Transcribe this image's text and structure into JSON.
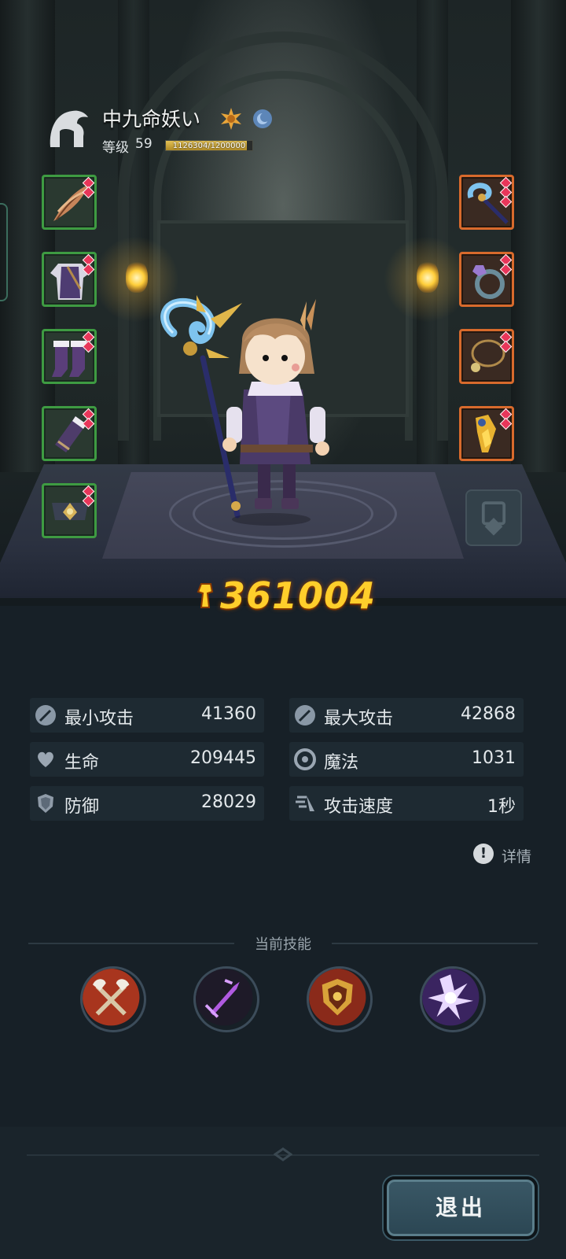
{
  "player": {
    "name": "中九命妖い",
    "level_label": "等级",
    "level": "59",
    "xp_text": "1126304/1200000",
    "xp_fraction": 0.9386
  },
  "equipment": {
    "left": [
      {
        "item": "feather-quill",
        "icon": "feather-icon"
      },
      {
        "item": "purple-tunic",
        "icon": "armor-icon"
      },
      {
        "item": "purple-boots",
        "icon": "boots-icon"
      },
      {
        "item": "bracer",
        "icon": "bracer-icon"
      },
      {
        "item": "belt",
        "icon": "belt-icon"
      }
    ],
    "right": [
      {
        "item": "ice-staff",
        "icon": "staff-icon"
      },
      {
        "item": "gem-ring",
        "icon": "ring-icon"
      },
      {
        "item": "necklace",
        "icon": "necklace-icon"
      },
      {
        "item": "gold-amulet",
        "icon": "amulet-icon"
      }
    ]
  },
  "power": "361004",
  "stats": [
    {
      "label": "最小攻击",
      "value": "41360",
      "icon": "sword-icon"
    },
    {
      "label": "最大攻击",
      "value": "42868",
      "icon": "sword-icon"
    },
    {
      "label": "生命",
      "value": "209445",
      "icon": "heart-icon"
    },
    {
      "label": "魔法",
      "value": "1031",
      "icon": "magic-icon"
    },
    {
      "label": "防御",
      "value": "28029",
      "icon": "shield-icon"
    },
    {
      "label": "攻击速度",
      "value": "1秒",
      "icon": "speed-icon"
    }
  ],
  "details_label": "详情",
  "skills": {
    "title": "当前技能",
    "items": [
      {
        "name": "crossed-axes",
        "icon": "axes-icon"
      },
      {
        "name": "purple-sword",
        "icon": "purple-sword-icon"
      },
      {
        "name": "golden-shield",
        "icon": "shield-crest-icon"
      },
      {
        "name": "lightning-burst",
        "icon": "lightning-icon"
      }
    ]
  },
  "exit_label": "退出",
  "colors": {
    "power": "#ffce2b",
    "common_slot": "#3e9b42",
    "rare_slot": "#d86a2c",
    "background": "#172027"
  }
}
